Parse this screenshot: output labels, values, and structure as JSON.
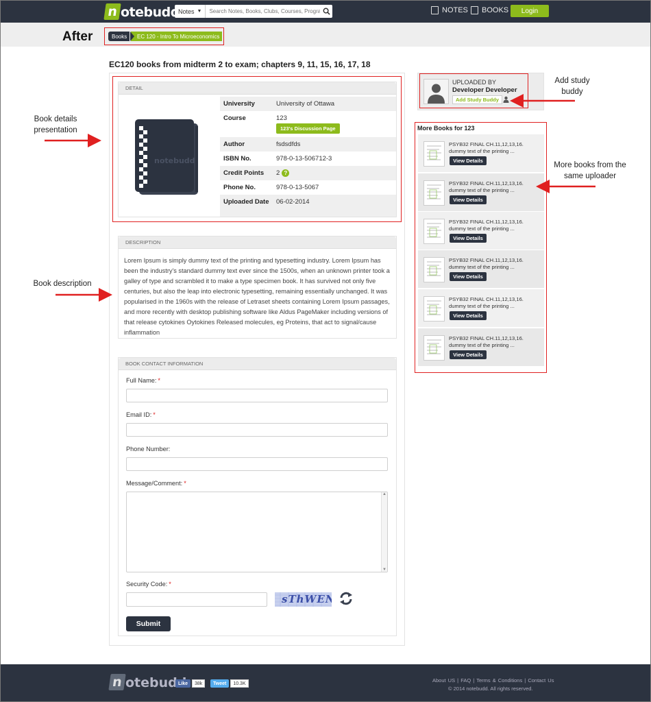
{
  "header": {
    "logo_text": "otebudd",
    "logo_letter": "n",
    "search_dropdown": "Notes",
    "search_placeholder": "Search Notes, Books, Clubs, Courses, Programs",
    "nav_notes": "NOTES",
    "nav_books": "BOOKS",
    "login": "Login"
  },
  "band": {
    "after_label": "After",
    "breadcrumb": [
      "Books",
      "EC 120 - Intro To Microeconomics"
    ]
  },
  "page_title": "EC120 books from midterm 2 to exam; chapters 9, 11, 15, 16, 17, 18",
  "detail": {
    "header": "DETAIL",
    "rows": [
      {
        "label": "University",
        "value": "University of Ottawa"
      },
      {
        "label": "Course",
        "value": "123",
        "button": "123's Discussion Page"
      },
      {
        "label": "Author",
        "value": "fsdsdfds"
      },
      {
        "label": "ISBN No.",
        "value": "978-0-13-506712-3"
      },
      {
        "label": "Credit Points",
        "value": "2"
      },
      {
        "label": "Phone No.",
        "value": "978-0-13-5067"
      },
      {
        "label": "Uploaded Date",
        "value": "06-02-2014"
      }
    ],
    "credit_help": "?"
  },
  "description": {
    "header": "DESCRIPTION",
    "text": "Lorem Ipsum is simply dummy text of the printing and typesetting industry. Lorem Ipsum has been the industry's standard dummy text ever since the 1500s, when an unknown printer took a galley of type and scrambled it to make a type specimen book. It has survived not only five centuries, but also the leap into electronic typesetting, remaining essentially unchanged. It was popularised in the 1960s with the release of Letraset sheets containing Lorem Ipsum passages, and more recently with desktop publishing software like Aldus PageMaker including versions of that release cytokines Oytokines Released molecules, eg Proteins, that act to signal/cause inflammation"
  },
  "contact": {
    "header": "BOOK CONTACT INFORMATION",
    "full_name": "Full Name:",
    "email": "Email ID:",
    "phone": "Phone Number:",
    "message": "Message/Comment:",
    "security": "Security Code:",
    "required_mark": "*",
    "captcha_text": "sThWEN",
    "submit": "Submit"
  },
  "uploader": {
    "label": "UPLOADED BY",
    "name": "Developer Developer",
    "button": "Add Study Buddy"
  },
  "more_books": {
    "title": "More Books for 123",
    "items": [
      {
        "title": "PSYB32 FINAL CH.11,12,13,16.",
        "snippet": "dummy text of the printing ...",
        "button": "View Details"
      },
      {
        "title": "PSYB32 FINAL CH.11,12,13,16.",
        "snippet": "dummy text of the printing ...",
        "button": "View Details"
      },
      {
        "title": "PSYB32 FINAL CH.11,12,13,16.",
        "snippet": "dummy text of the printing ...",
        "button": "View Details"
      },
      {
        "title": "PSYB32 FINAL CH.11,12,13,16.",
        "snippet": "dummy text of the printing ...",
        "button": "View Details"
      },
      {
        "title": "PSYB32 FINAL CH.11,12,13,16.",
        "snippet": "dummy text of the printing ...",
        "button": "View Details"
      },
      {
        "title": "PSYB32 FINAL CH.11,12,13,16.",
        "snippet": "dummy text of the printing ...",
        "button": "View Details"
      }
    ]
  },
  "annotations": {
    "book_details": "Book details presentation",
    "book_description": "Book description",
    "study_buddy": "Add study buddy",
    "more_books": "More books from the same uploader"
  },
  "footer": {
    "like": "Like",
    "like_count": "38k",
    "tweet": "Tweet",
    "tweet_count": "10.3K",
    "links": "About US | FAQ | Terms & Conditions | Contact Us",
    "copyright": "© 2014 notebudd. All rights reserved."
  },
  "colors": {
    "dark": "#2c3340",
    "green": "#8dbb1c",
    "annotation_red": "#e02020"
  }
}
